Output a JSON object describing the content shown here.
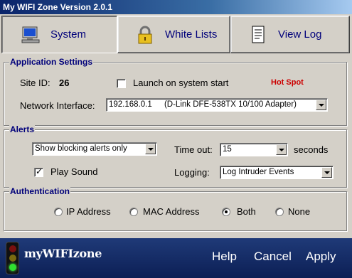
{
  "window": {
    "title": "My WIFI Zone Version 2.0.1"
  },
  "toolbar": {
    "system_label": "System",
    "white_lists_label": "White Lists",
    "view_log_label": "View Log"
  },
  "app_settings": {
    "title": "Application Settings",
    "site_id_label": "Site ID:",
    "site_id_value": "26",
    "launch_label": "Launch on system start",
    "launch_checked": false,
    "hotspot_label": "Hot Spot",
    "interface_label": "Network Interface:",
    "interface_ip": "192.168.0.1",
    "interface_adapter": "(D-Link DFE-538TX 10/100 Adapter)"
  },
  "alerts": {
    "title": "Alerts",
    "blocking_value": "Show blocking alerts only",
    "timeout_label": "Time out:",
    "timeout_value": "15",
    "seconds_label": "seconds",
    "play_sound_label": "Play Sound",
    "play_sound_checked": true,
    "logging_label": "Logging:",
    "logging_value": "Log Intruder Events"
  },
  "authentication": {
    "title": "Authentication",
    "options": [
      "IP Address",
      "MAC Address",
      "Both",
      "None"
    ],
    "selected": "Both"
  },
  "footer": {
    "brand": "myWIFIzone",
    "help_label": "Help",
    "cancel_label": "Cancel",
    "apply_label": "Apply"
  },
  "colors": {
    "accent": "#00007a",
    "hotspot": "#cc0000",
    "footer_bg": "#12296a"
  },
  "icons": {
    "system": "computer-monitor-icon",
    "white_lists": "padlock-icon",
    "view_log": "document-icon",
    "brand": "traffic-light-icon"
  }
}
